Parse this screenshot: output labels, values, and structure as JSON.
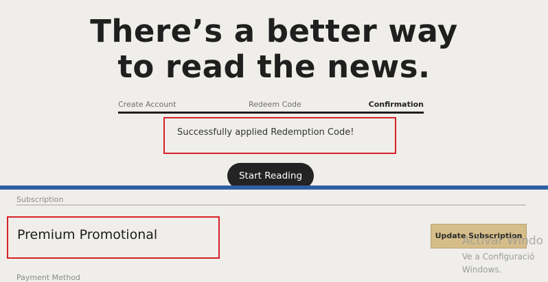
{
  "hero": {
    "headline_line1": "There’s a better way",
    "headline_line2": "to read the news."
  },
  "steps": {
    "items": [
      "Create Account",
      "Redeem Code",
      "Confirmation"
    ],
    "active": "Confirmation"
  },
  "success": {
    "message": "Successfully applied Redemption Code!"
  },
  "start_button": {
    "label": "Start Reading"
  },
  "account": {
    "subscription_label": "Subscription",
    "plan_name": "Premium Promotional",
    "update_button": "Update Subscription",
    "payment_label": "Payment Method"
  },
  "watermark": {
    "title": "Activar Windo",
    "line1": "Ve a Configuració",
    "line2": "Windows."
  },
  "colors": {
    "highlight_box": "#d71f26",
    "primary_button": "#232323",
    "update_button": "#d6be8a",
    "divider": "#2e5fa3"
  }
}
